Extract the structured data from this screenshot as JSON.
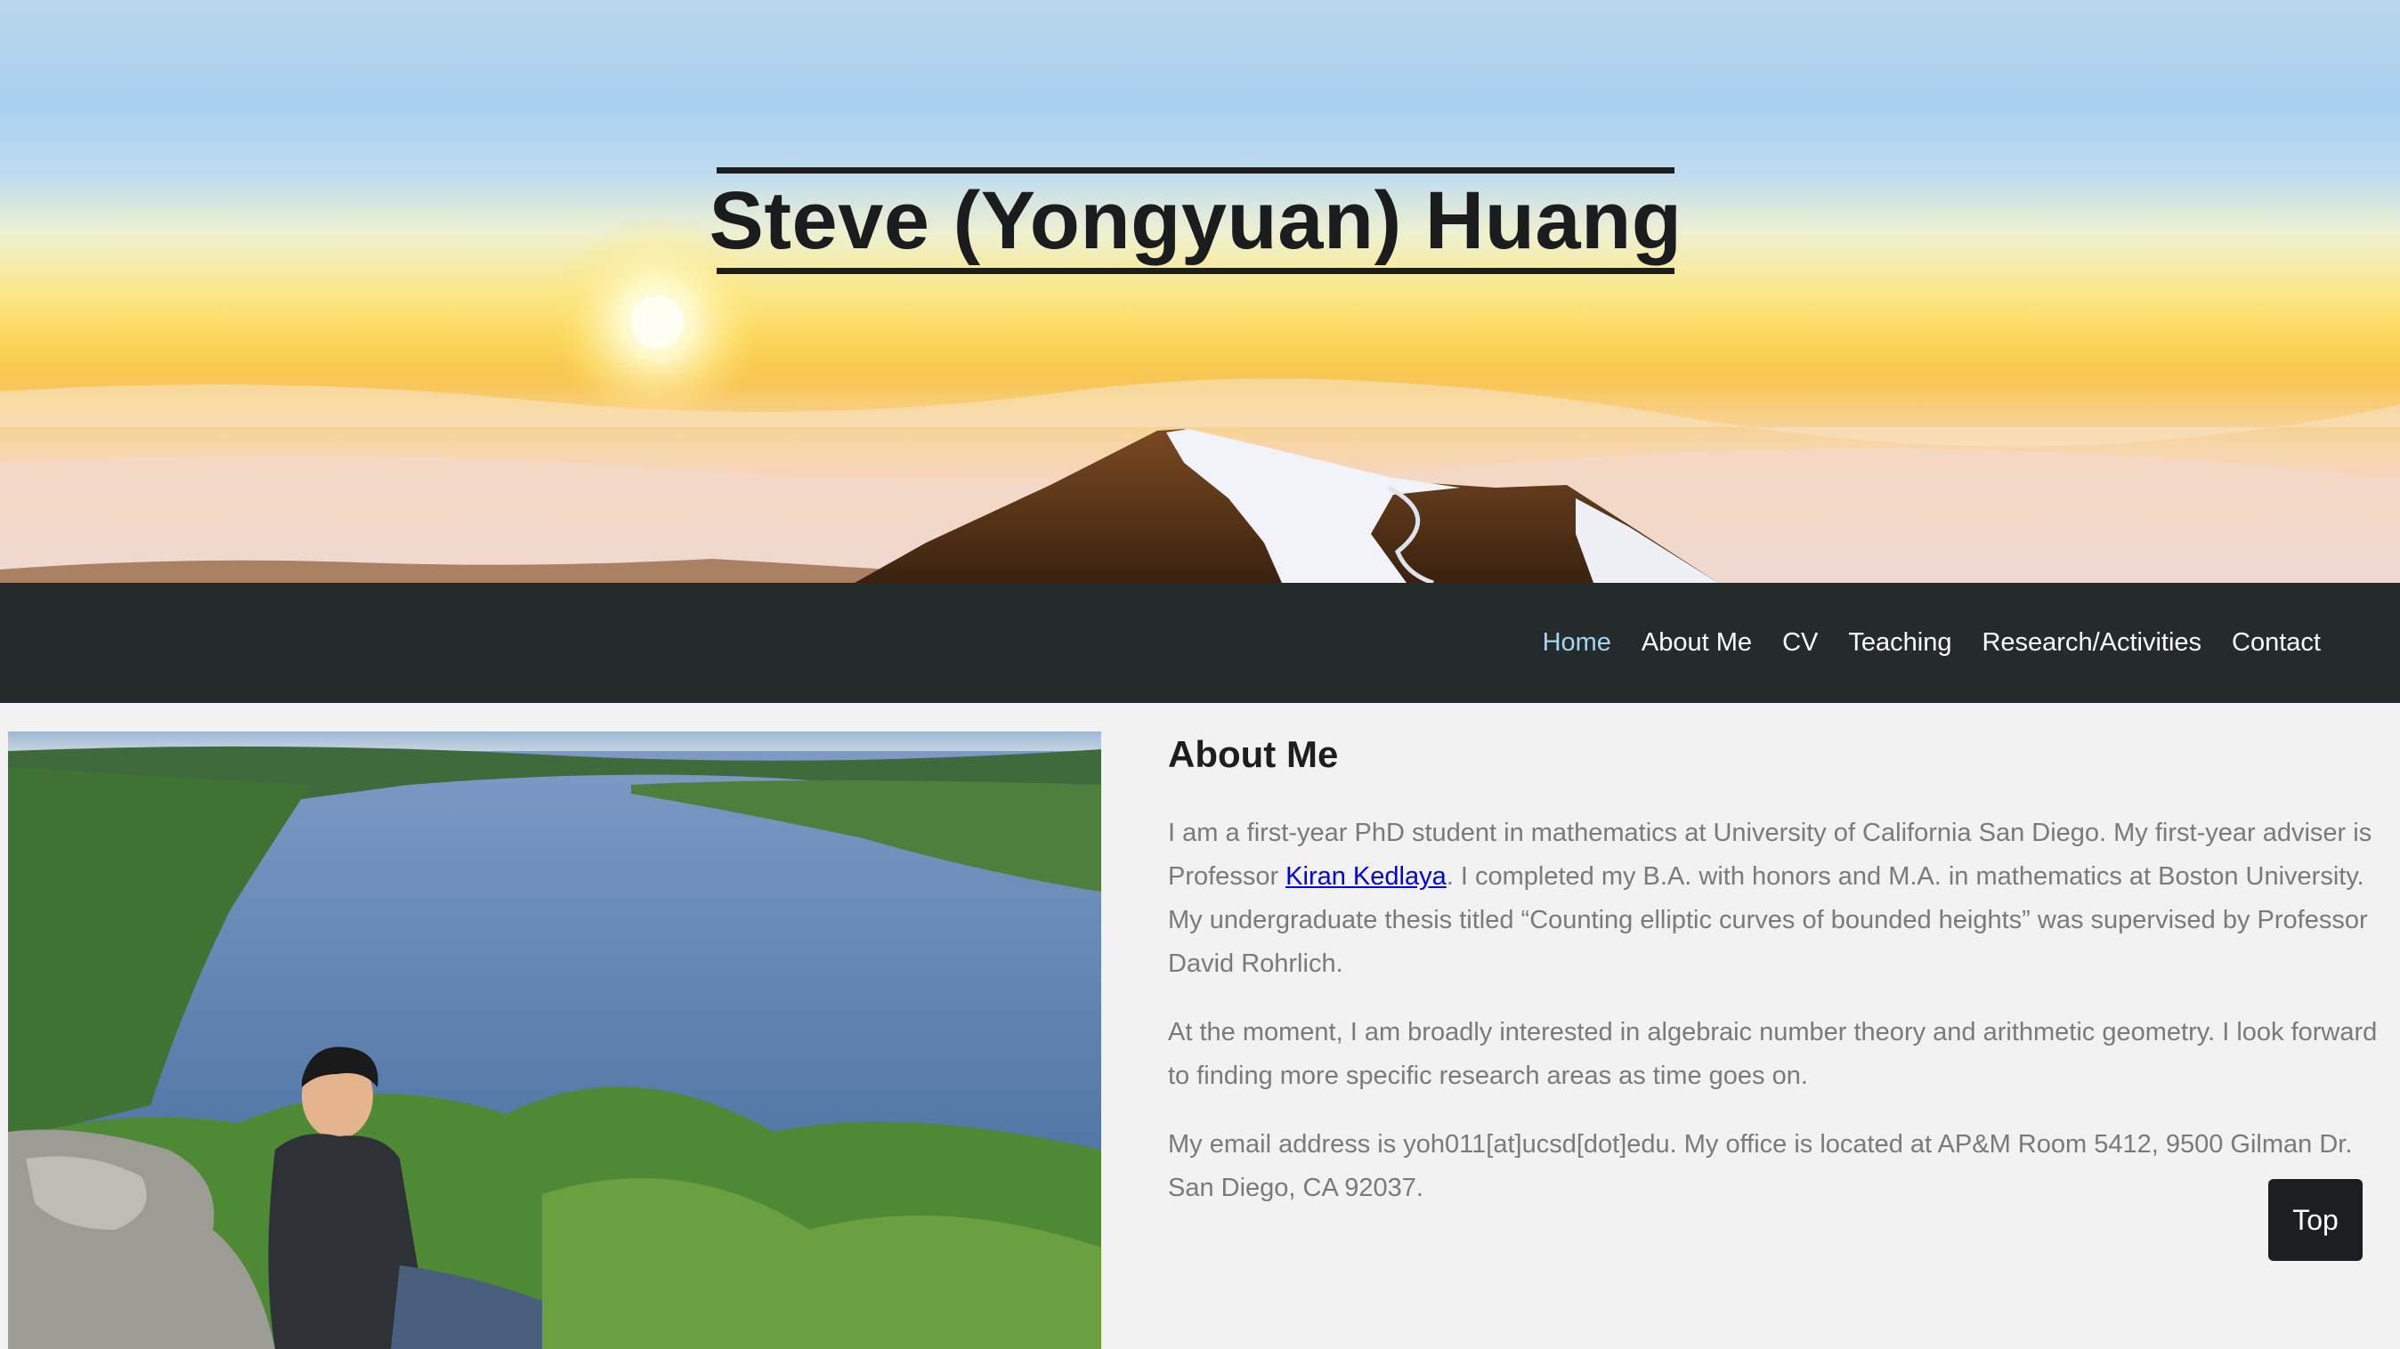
{
  "header": {
    "title": "Steve (Yongyuan) Huang"
  },
  "nav": {
    "items": [
      {
        "label": "Home",
        "active": true
      },
      {
        "label": "About Me",
        "active": false
      },
      {
        "label": "CV",
        "active": false
      },
      {
        "label": "Teaching",
        "active": false
      },
      {
        "label": "Research/Activities",
        "active": false
      },
      {
        "label": "Contact",
        "active": false
      }
    ],
    "active_color": "#9fd7f3"
  },
  "about": {
    "heading": "About Me",
    "p1_before": "I am a first-year PhD student in mathematics at University of California San Diego. My first-year adviser is Professor ",
    "p1_link": "Kiran Kedlaya",
    "p1_after": ". I completed my B.A. with honors and M.A. in mathematics at Boston University. My undergraduate thesis titled “Counting elliptic curves of bounded heights” was supervised by Professor David Rohrlich.",
    "p2": "At the moment, I am broadly interested in algebraic number theory and arithmetic geometry. I look forward to finding more specific research areas as time goes on.",
    "p3": "My email address is yoh011[at]ucsd[dot]edu. My office is located at AP&M Room 5412, 9500 Gilman Dr. San Diego, CA 92037."
  },
  "back_to_top": {
    "label": "Top"
  },
  "colors": {
    "navbar_bg": "#252b2d",
    "page_bg": "#f2f2f2",
    "link": "#0000ee"
  }
}
